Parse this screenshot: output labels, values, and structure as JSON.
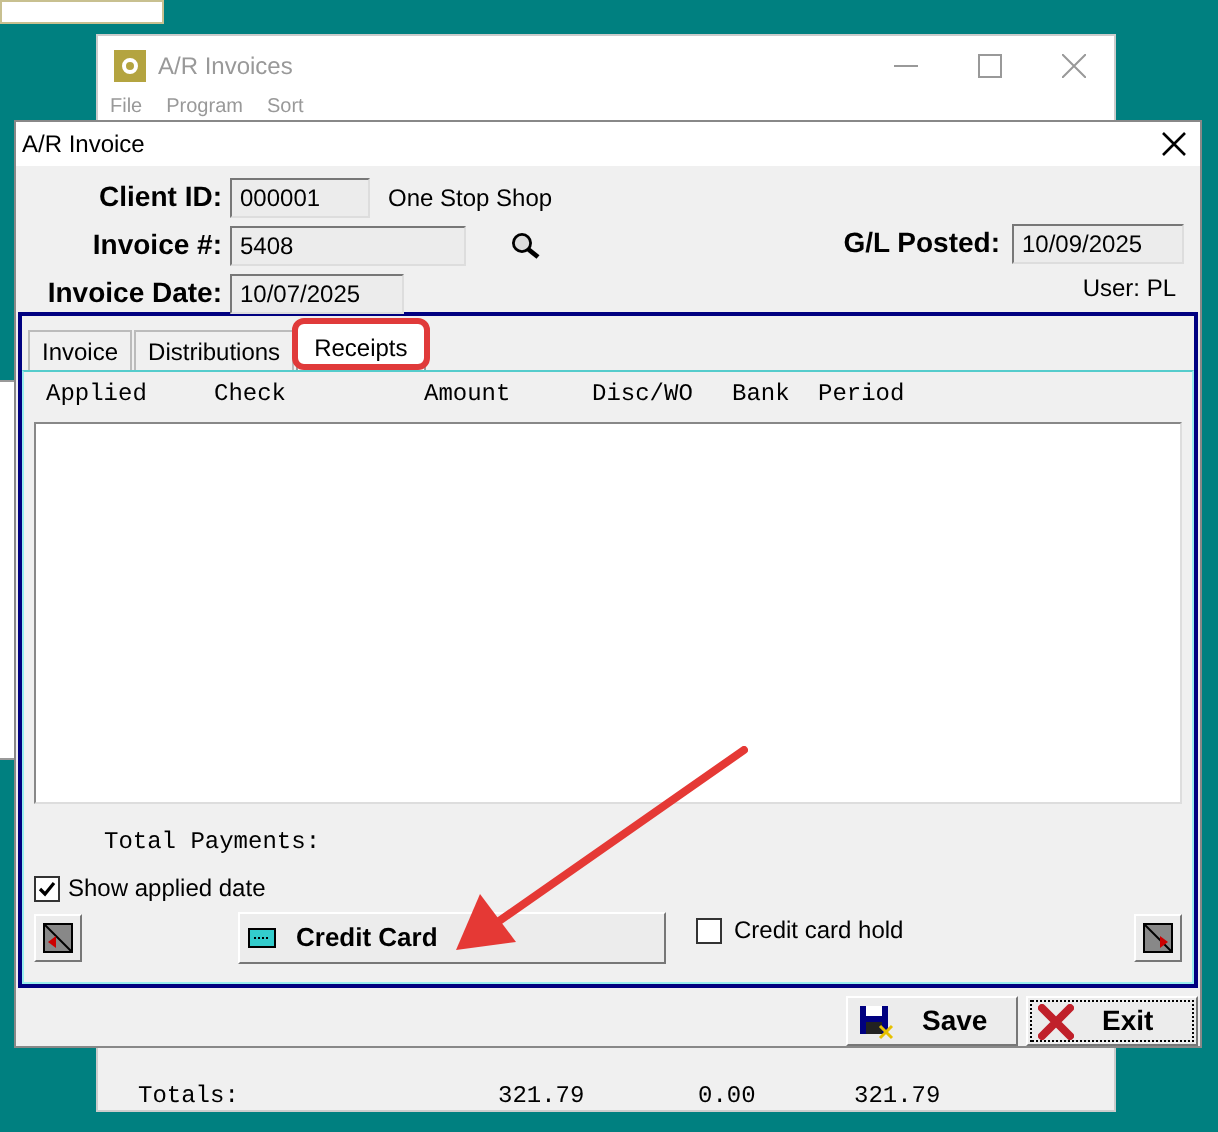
{
  "background_window": {
    "title": "A/R Invoices",
    "menu": [
      "File",
      "Program",
      "Sort"
    ],
    "totals": {
      "label": "Totals:",
      "values": [
        "321.79",
        "0.00",
        "321.79"
      ]
    }
  },
  "dialog": {
    "title": "A/R Invoice",
    "client_id": {
      "label": "Client ID:",
      "value": "000001",
      "name": "One Stop Shop"
    },
    "invoice_no": {
      "label": "Invoice #:",
      "value": "5408"
    },
    "invoice_date": {
      "label": "Invoice Date:",
      "value": "10/07/2025"
    },
    "gl_posted": {
      "label": "G/L Posted:",
      "value": "10/09/2025"
    },
    "user": "User: PL",
    "tabs": [
      {
        "label": "Invoice",
        "selected": false
      },
      {
        "label": "Distributions",
        "selected": false
      },
      {
        "label": "Receipts",
        "selected": true,
        "highlighted": true
      }
    ],
    "columns": [
      "Applied",
      "Check",
      "Amount",
      "Disc/WO",
      "Bank",
      "Period"
    ],
    "total_payments": "Total Payments:",
    "show_applied_date": {
      "label": "Show applied date",
      "checked": true
    },
    "credit_card_button": "Credit Card",
    "credit_card_hold": {
      "label": "Credit card hold",
      "checked": false
    },
    "buttons": [
      {
        "label": "Save",
        "kind": "save"
      },
      {
        "label": "Exit",
        "kind": "exit"
      }
    ]
  }
}
